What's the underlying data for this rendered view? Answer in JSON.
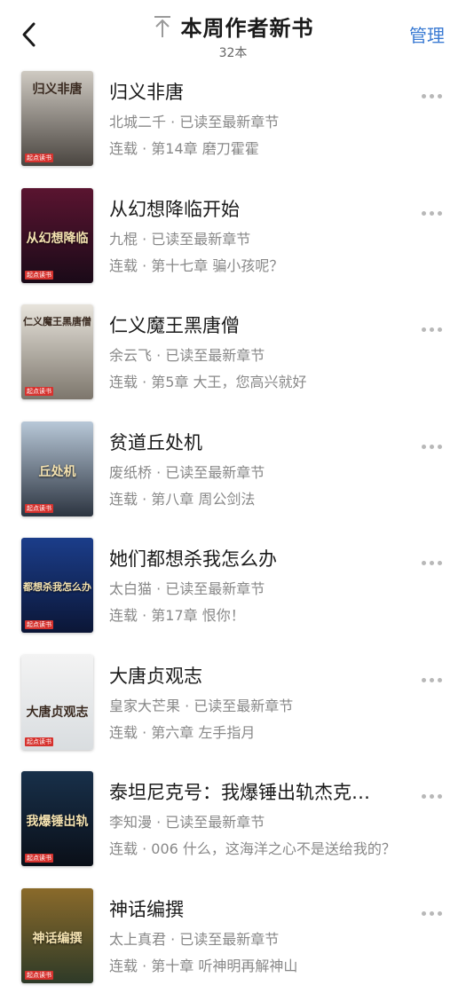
{
  "header": {
    "title": "本周作者新书",
    "count": "32本",
    "manage_label": "管理"
  },
  "books": [
    {
      "title": "归义非唐",
      "author_status": "北城二千 · 已读至最新章节",
      "chapter": "连载 · 第14章 磨刀霍霍",
      "cover_text": "归义非唐",
      "cover_colors": [
        "#cfcac2",
        "#4a4540"
      ]
    },
    {
      "title": "从幻想降临开始",
      "author_status": "九棍 · 已读至最新章节",
      "chapter": "连载 · 第十七章 骗小孩呢？",
      "cover_text": "从幻想降临",
      "cover_colors": [
        "#5a1430",
        "#1a0a18"
      ]
    },
    {
      "title": "仁义魔王黑唐僧",
      "author_status": "余云飞 · 已读至最新章节",
      "chapter": "连载 · 第5章 大王，您高兴就好",
      "cover_text": "仁义魔王黑唐僧",
      "cover_colors": [
        "#e8e4dc",
        "#7d766c"
      ]
    },
    {
      "title": "贫道丘处机",
      "author_status": "废纸桥 · 已读至最新章节",
      "chapter": "连载 · 第八章 周公剑法",
      "cover_text": "丘处机",
      "cover_colors": [
        "#b8c8d8",
        "#2c3440"
      ]
    },
    {
      "title": "她们都想杀我怎么办",
      "author_status": "太白猫 · 已读至最新章节",
      "chapter": "连载 · 第17章 恨你！",
      "cover_text": "都想杀我怎么办",
      "cover_colors": [
        "#1b3d8a",
        "#0b1636"
      ]
    },
    {
      "title": "大唐贞观志",
      "author_status": "皇家大芒果 · 已读至最新章节",
      "chapter": "连载 · 第六章 左手指月",
      "cover_text": "大唐贞观志",
      "cover_colors": [
        "#f3f3f3",
        "#d9dde0"
      ]
    },
    {
      "title": "泰坦尼克号：我爆锤出轨杰克…",
      "author_status": "李知漫 · 已读至最新章节",
      "chapter": "连载 · 006 什么，这海洋之心不是送给我的？",
      "cover_text": "我爆锤出轨",
      "cover_colors": [
        "#18304a",
        "#0a0f18"
      ]
    },
    {
      "title": "神话编撰",
      "author_status": "太上真君 · 已读至最新章节",
      "chapter": "连载 · 第十章 听神明再解神山",
      "cover_text": "神话编撰",
      "cover_colors": [
        "#8a6a2a",
        "#2e3a28"
      ]
    }
  ],
  "publisher_badge": "起点读书",
  "accent_color": "#3b7bd3"
}
